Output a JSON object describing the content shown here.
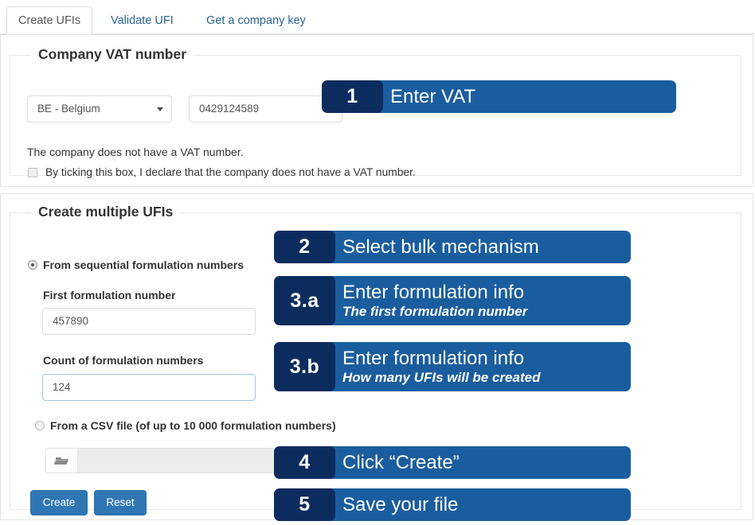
{
  "tabs": [
    {
      "label": "Create UFIs",
      "active": true
    },
    {
      "label": "Validate UFI",
      "active": false
    },
    {
      "label": "Get a company key",
      "active": false
    }
  ],
  "vat_section": {
    "legend": "Company VAT number",
    "country_select": {
      "value": "BE - Belgium",
      "caret_icon": "chevron-down-icon"
    },
    "vat_input": {
      "value": "0429124589",
      "placeholder": ""
    },
    "no_vat_text": "The company does not have a VAT number.",
    "no_vat_checkbox": {
      "label": "By ticking this box, I declare that the company does not have a VAT number.",
      "checked": false
    }
  },
  "bulk_section": {
    "legend": "Create multiple UFIs",
    "radio_sequential": {
      "label": "From sequential formulation numbers",
      "selected": true
    },
    "first_number": {
      "label": "First formulation number",
      "value": "457890"
    },
    "count_number": {
      "label": "Count of formulation numbers",
      "value": "124",
      "focused": true
    },
    "radio_csv": {
      "label": "From a CSV file (of up to 10 000 formulation numbers)",
      "selected": false
    },
    "file_picker": {
      "browse_icon": "folder-icon",
      "filename": ""
    },
    "create_button": "Create",
    "reset_button": "Reset"
  },
  "callouts": [
    {
      "number": "1",
      "title": "Enter VAT",
      "sub": ""
    },
    {
      "number": "2",
      "title": "Select bulk mechanism",
      "sub": ""
    },
    {
      "number": "3.a",
      "title": "Enter formulation info",
      "sub": "The first formulation number"
    },
    {
      "number": "3.b",
      "title": "Enter formulation info",
      "sub": "How many UFIs will be created"
    },
    {
      "number": "4",
      "title": "Click “Create”",
      "sub": ""
    },
    {
      "number": "5",
      "title": "Save your file",
      "sub": ""
    }
  ],
  "colors": {
    "callout_bg": "#1a5d9e",
    "callout_number_bg": "#0d2c5e",
    "button_blue": "#3076b5",
    "link_blue": "#2a6496"
  }
}
